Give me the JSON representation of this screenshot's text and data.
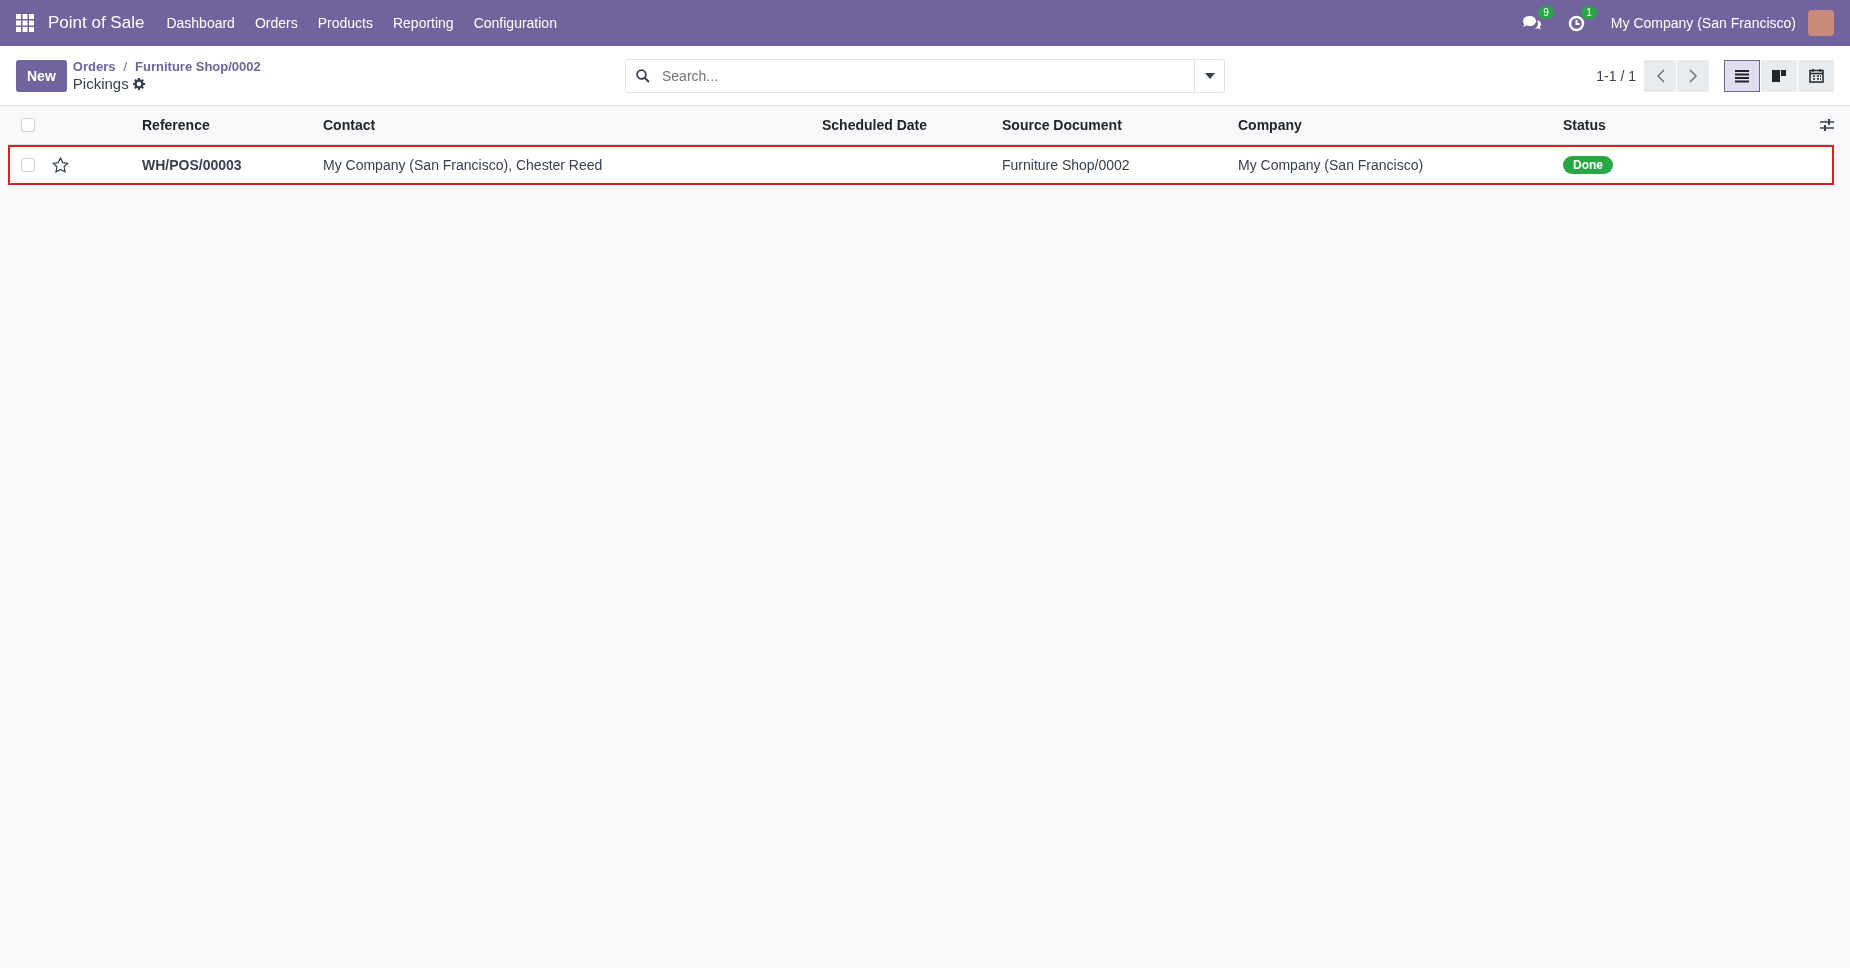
{
  "navbar": {
    "app_name": "Point of Sale",
    "menu": [
      "Dashboard",
      "Orders",
      "Products",
      "Reporting",
      "Configuration"
    ],
    "messages_count": "9",
    "activities_count": "1",
    "company": "My Company (San Francisco)"
  },
  "control_panel": {
    "new_button": "New",
    "breadcrumbs": [
      "Orders",
      "Furniture Shop/0002"
    ],
    "breadcrumb_separator": "/",
    "title": "Pickings",
    "search": {
      "placeholder": "Search..."
    },
    "pager": "1-1 / 1",
    "views": [
      {
        "kind": "list",
        "selected": true
      },
      {
        "kind": "kanban",
        "selected": false
      },
      {
        "kind": "calendar",
        "selected": false
      }
    ]
  },
  "table": {
    "select_all": {
      "checked": false
    },
    "columns": [
      "Reference",
      "Contact",
      "Scheduled Date",
      "Source Document",
      "Company",
      "Status"
    ],
    "rows": [
      {
        "checked": false,
        "starred": false,
        "highlighted": true,
        "cells": [
          "WH/POS/00003",
          "My Company (San Francisco), Chester Reed",
          "",
          "Furniture Shop/0002",
          "My Company (San Francisco)"
        ],
        "status": {
          "label": "Done",
          "color": "#28a745"
        }
      }
    ]
  }
}
